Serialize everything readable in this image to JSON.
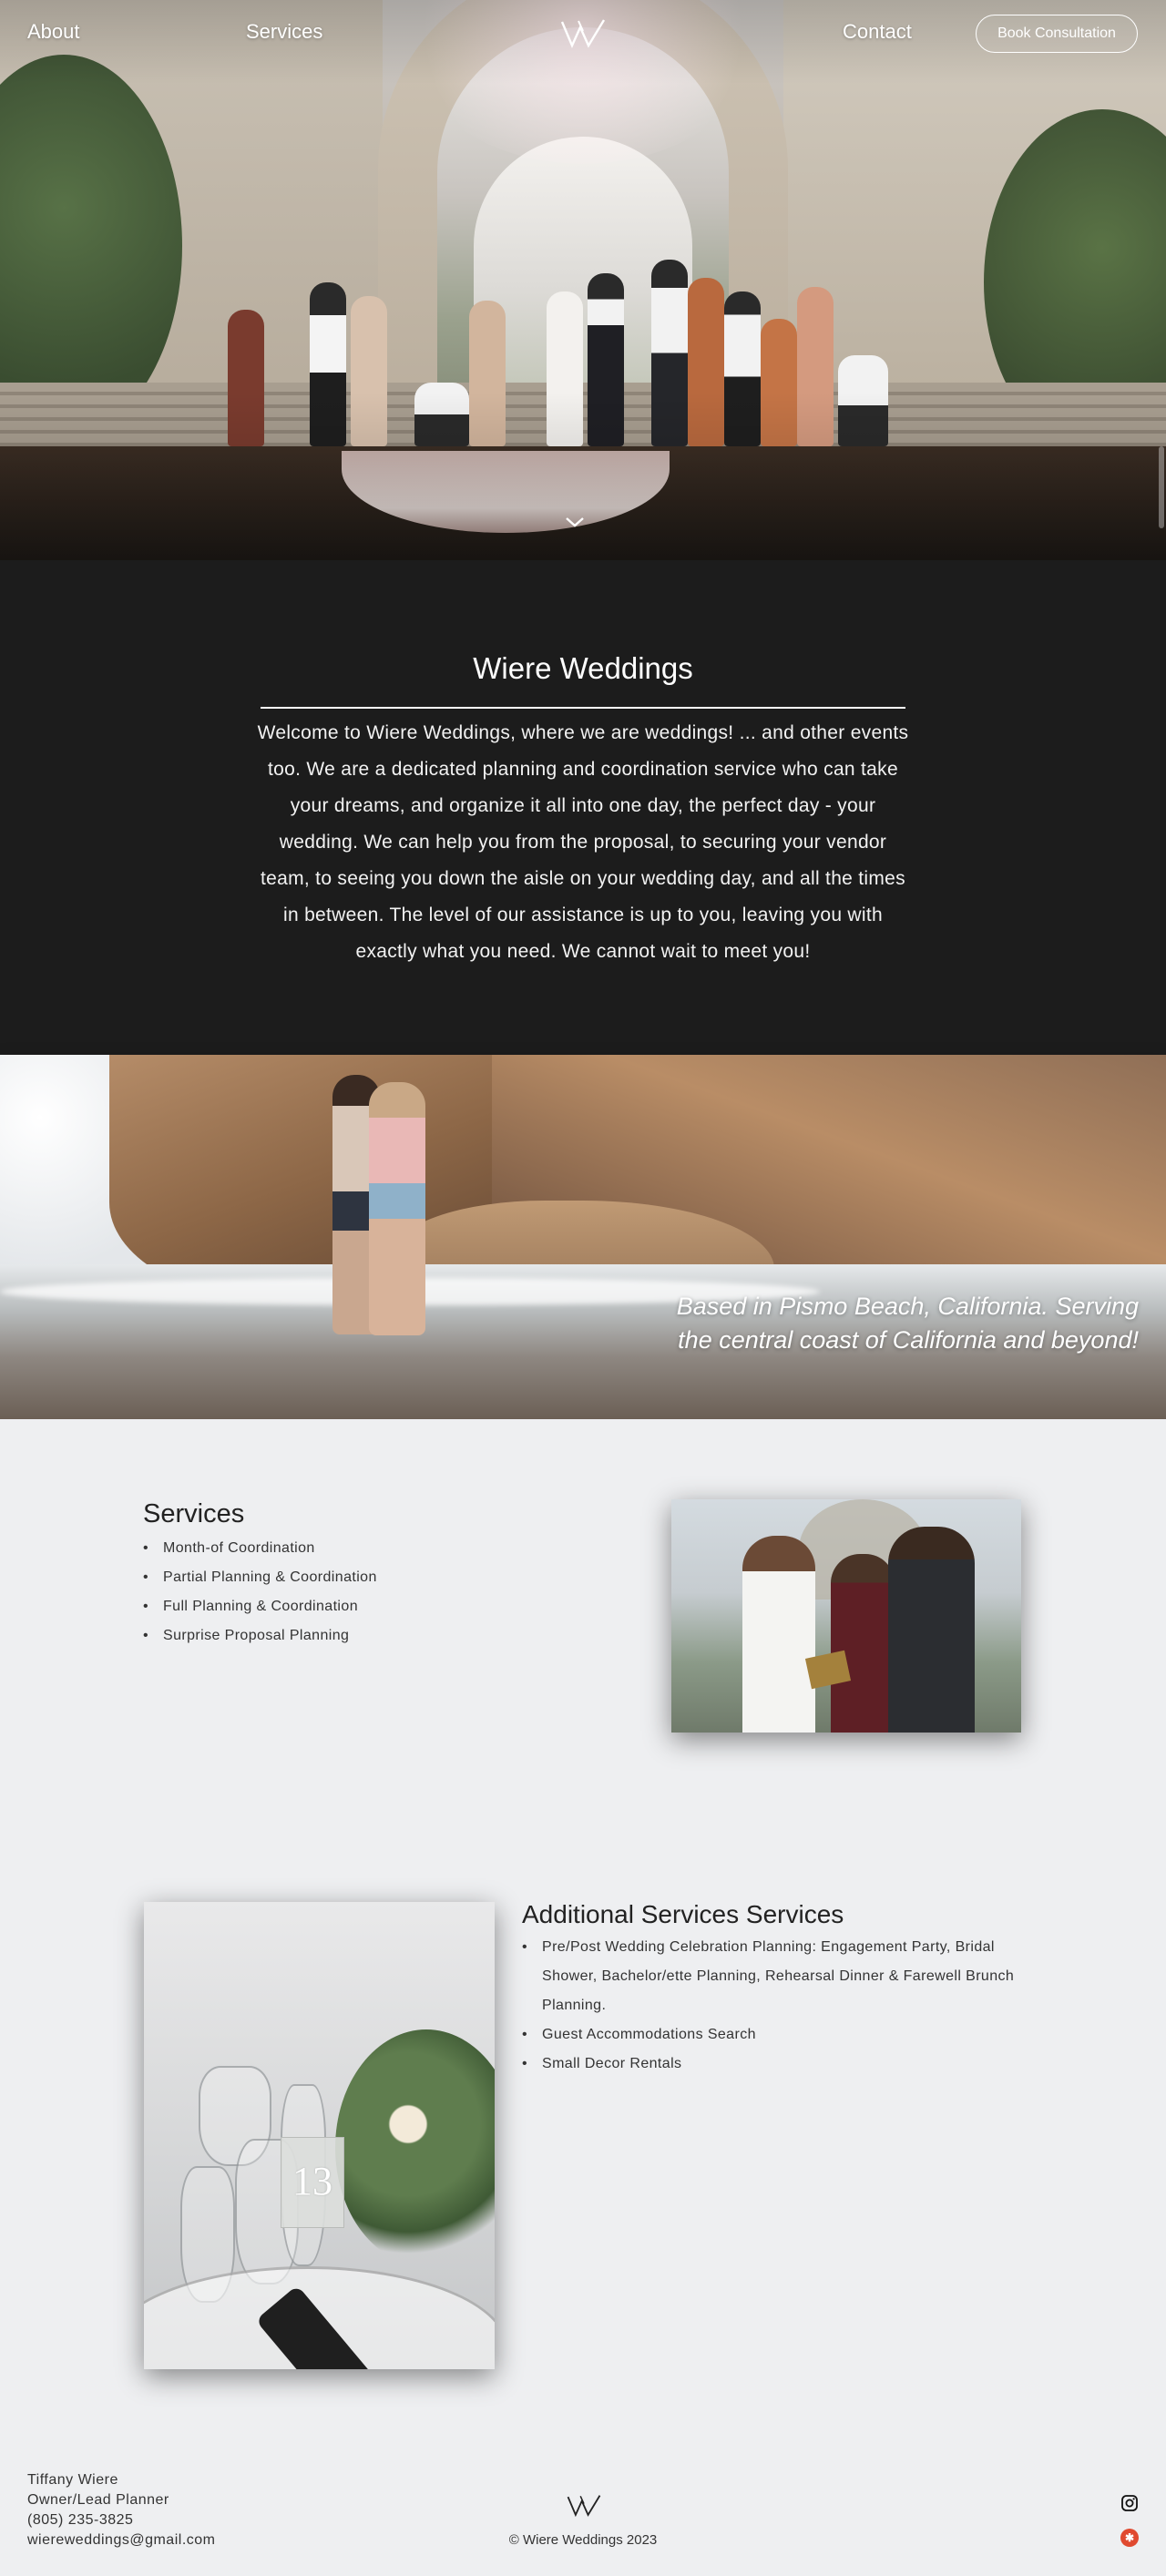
{
  "nav": {
    "about": "About",
    "services": "Services",
    "contact": "Contact",
    "book_button": "Book Consultation",
    "logo_icon": "wiere-logo-icon",
    "scroll_icon": "chevron-down-icon"
  },
  "intro": {
    "title": "Wiere Weddings",
    "body": "Welcome to Wiere Weddings, where we are weddings! ... and other events too. We are a dedicated planning and coordination service who can take your dreams, and organize it all into one day, the perfect day - your wedding. We can help you from the proposal, to securing your vendor team, to seeing you down the aisle on your wedding day, and all the times in between. The level of our assistance is up to you, leaving you with exactly what you need. We cannot wait to meet you!"
  },
  "beach": {
    "caption": "Based in Pismo Beach, California. Serving the central coast of California and beyond!"
  },
  "services": {
    "title": "Services",
    "items": [
      "Month-of Coordination",
      "Partial Planning & Coordination",
      "Full Planning & Coordination",
      "Surprise Proposal Planning"
    ]
  },
  "additional": {
    "title": "Additional Services Services",
    "items": [
      "Pre/Post Wedding Celebration Planning: Engagement Party, Bridal Shower, Bachelor/ette Planning, Rehearsal Dinner & Farewell Brunch Planning.",
      "Guest Accommodations Search",
      "Small Decor Rentals"
    ],
    "table_number": "13"
  },
  "footer": {
    "name": "Tiffany Wiere",
    "role": "Owner/Lead Planner",
    "phone": "(805) 235-3825",
    "email": "wiereweddings@gmail.com",
    "copyright": "© Wiere Weddings 2023",
    "instagram_icon": "instagram-icon",
    "yelp_icon": "yelp-icon"
  },
  "colors": {
    "dark_section": "#1c1c1c",
    "page_background": "#eeeff1",
    "yelp_red": "#e0492f"
  }
}
